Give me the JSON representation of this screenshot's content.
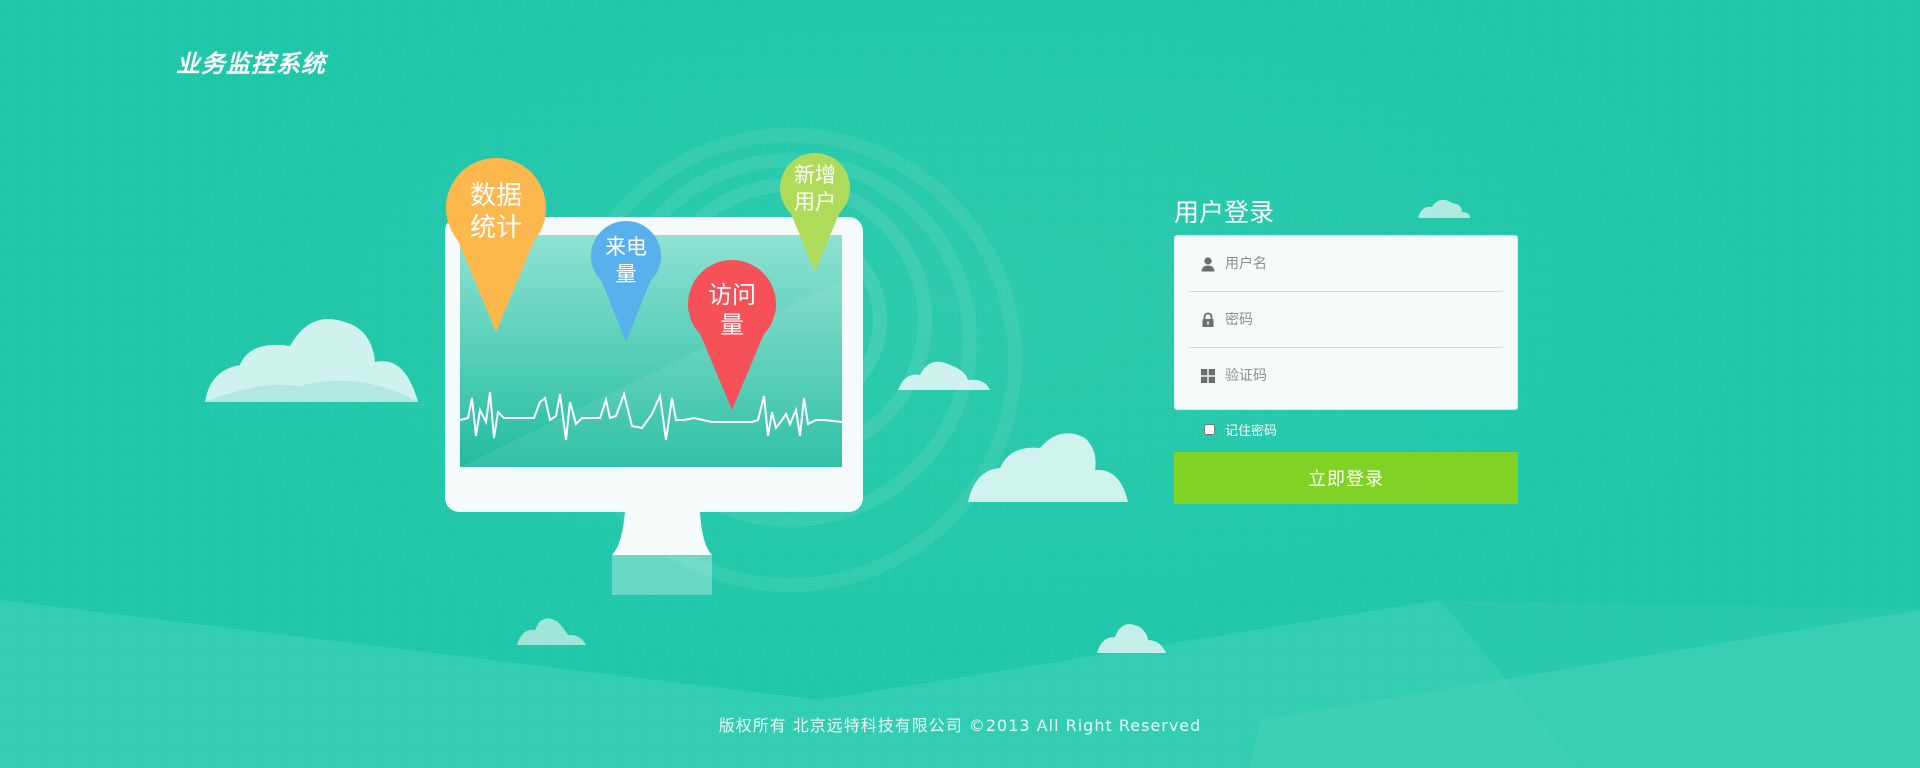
{
  "header": {
    "title": "业务监控系统"
  },
  "pins": {
    "data_stats": "数据统计",
    "data_stats_l1": "数据",
    "data_stats_l2": "统计",
    "calls_l1": "来电",
    "calls_l2": "量",
    "visits_l1": "访问",
    "visits_l2": "量",
    "new_users_l1": "新增",
    "new_users_l2": "用户"
  },
  "login": {
    "title": "用户登录",
    "username_placeholder": "用户名",
    "password_placeholder": "密码",
    "captcha_placeholder": "验证码",
    "remember_label": "记住密码",
    "submit_label": "立即登录"
  },
  "footer": {
    "text": "版权所有 北京远特科技有限公司  ©2013  All Right Reserved"
  },
  "colors": {
    "background": "#1cc6a8",
    "button": "#80d324",
    "pin_orange": "#fcb84c",
    "pin_blue": "#58b1ec",
    "pin_red": "#f65058",
    "pin_green": "#aedc5a"
  },
  "icons": [
    "user-icon",
    "lock-icon",
    "grid-icon"
  ]
}
